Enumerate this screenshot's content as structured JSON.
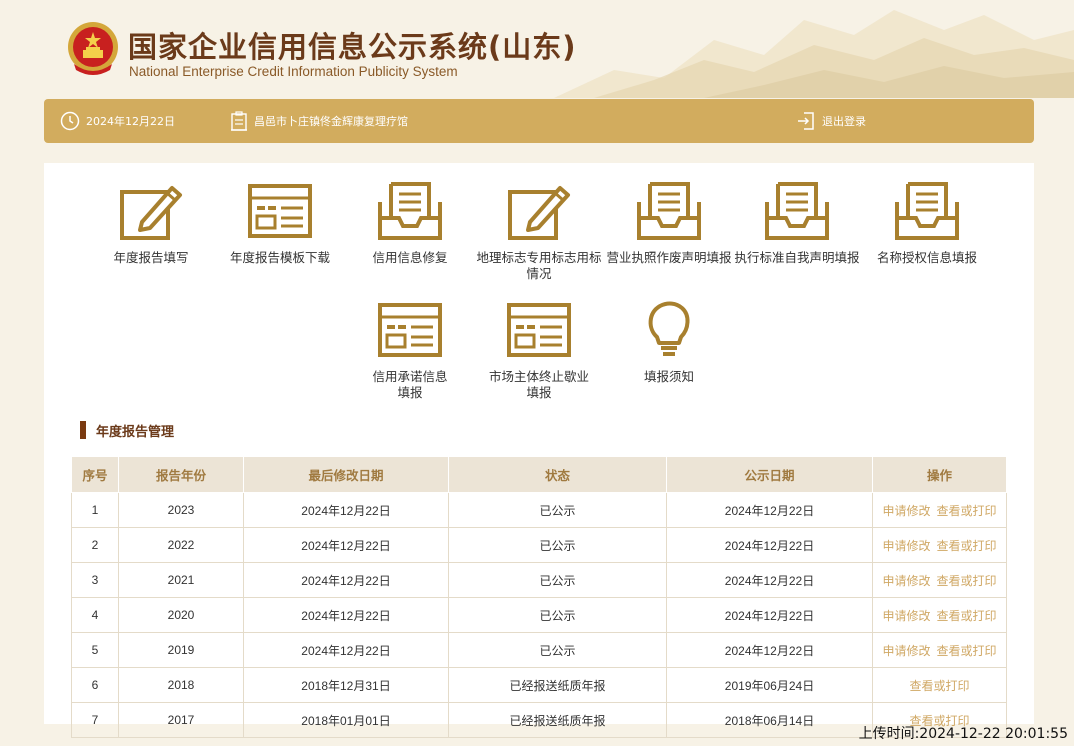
{
  "header": {
    "title_cn": "国家企业信用信息公示系统(山东)",
    "title_en": "National Enterprise Credit Information Publicity System",
    "brand_color": "#6b3a1a"
  },
  "topbar": {
    "date": "2024年12月22日",
    "company": "昌邑市卜庄镇佟金辉康复理疗馆",
    "logout": "退出登录",
    "bar_color": "#d2ac5e"
  },
  "tiles": [
    {
      "label": "年度报告填写",
      "icon": "edit-icon"
    },
    {
      "label": "年度报告模板下载",
      "icon": "template-icon"
    },
    {
      "label": "信用信息修复",
      "icon": "inbox-icon"
    },
    {
      "label": "地理标志专用标志用标情况",
      "icon": "edit-icon"
    },
    {
      "label": "营业执照作废声明填报",
      "icon": "inbox-icon"
    },
    {
      "label": "执行标准自我声明填报",
      "icon": "inbox-icon"
    },
    {
      "label": "名称授权信息填报",
      "icon": "inbox-icon"
    },
    {
      "label": "信用承诺信息填报",
      "icon": "template-icon"
    },
    {
      "label": "市场主体终止歇业填报",
      "icon": "template-icon"
    },
    {
      "label": "填报须知",
      "icon": "lightbulb-icon"
    }
  ],
  "section": {
    "title": "年度报告管理"
  },
  "table": {
    "headers": [
      "序号",
      "报告年份",
      "最后修改日期",
      "状态",
      "公示日期",
      "操作"
    ],
    "rows": [
      {
        "no": "1",
        "year": "2023",
        "modified": "2024年12月22日",
        "status": "已公示",
        "published": "2024年12月22日",
        "ops": [
          "申请修改",
          "查看或打印"
        ]
      },
      {
        "no": "2",
        "year": "2022",
        "modified": "2024年12月22日",
        "status": "已公示",
        "published": "2024年12月22日",
        "ops": [
          "申请修改",
          "查看或打印"
        ]
      },
      {
        "no": "3",
        "year": "2021",
        "modified": "2024年12月22日",
        "status": "已公示",
        "published": "2024年12月22日",
        "ops": [
          "申请修改",
          "查看或打印"
        ]
      },
      {
        "no": "4",
        "year": "2020",
        "modified": "2024年12月22日",
        "status": "已公示",
        "published": "2024年12月22日",
        "ops": [
          "申请修改",
          "查看或打印"
        ]
      },
      {
        "no": "5",
        "year": "2019",
        "modified": "2024年12月22日",
        "status": "已公示",
        "published": "2024年12月22日",
        "ops": [
          "申请修改",
          "查看或打印"
        ]
      },
      {
        "no": "6",
        "year": "2018",
        "modified": "2018年12月31日",
        "status": "已经报送纸质年报",
        "published": "2019年06月24日",
        "ops": [
          "查看或打印"
        ]
      },
      {
        "no": "7",
        "year": "2017",
        "modified": "2018年01月01日",
        "status": "已经报送纸质年报",
        "published": "2018年06月14日",
        "ops": [
          "查看或打印"
        ]
      }
    ]
  },
  "upload_time": "上传时间:2024-12-22 20:01:55",
  "icon_color": "#a8802e",
  "link_color": "#d0a865"
}
